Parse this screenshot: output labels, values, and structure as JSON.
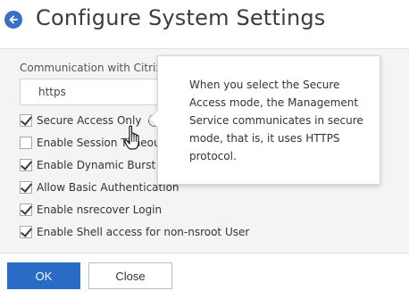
{
  "header": {
    "title": "Configure System Settings",
    "back_icon": "arrow-left-circle-icon",
    "accent_color": "#3a6fc4"
  },
  "form": {
    "communication_label": "Communication with Citrix A",
    "communication_value": "https",
    "checkboxes": [
      {
        "label": "Secure Access Only",
        "checked": true
      },
      {
        "label": "Enable Session Timeout",
        "checked": false
      },
      {
        "label": "Enable Dynamic Burst Th",
        "checked": true
      },
      {
        "label": "Allow Basic Authentication",
        "checked": true
      },
      {
        "label": "Enable nsrecover Login",
        "checked": true
      },
      {
        "label": "Enable Shell access for non-nsroot User",
        "checked": true
      }
    ],
    "info_icon": "info-icon"
  },
  "tooltip": {
    "text": "When you select the Secure Access mode, the Management Service communicates in secure mode, that is, it uses HTTPS protocol."
  },
  "footer": {
    "ok_label": "OK",
    "close_label": "Close",
    "primary_color": "#2a6bc6"
  }
}
